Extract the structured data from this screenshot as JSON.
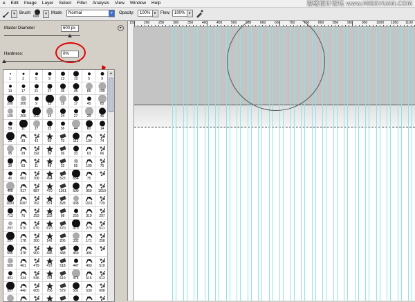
{
  "menubar": [
    "e",
    "Edit",
    "Image",
    "Layer",
    "Select",
    "Filter",
    "Analysis",
    "View",
    "Window",
    "Help"
  ],
  "watermark": "思缘设计论坛 www.MISSVUAN.COM",
  "options": {
    "brush_label": "Brush:",
    "brush_size": "600",
    "mode_label": "Mode:",
    "mode_value": "Normal",
    "opacity_label": "Opacity:",
    "opacity_value": "100%",
    "flow_label": "Flow:",
    "flow_value": "100%"
  },
  "brush_panel": {
    "master_label": "Master Diameter",
    "master_value": "600 px",
    "hardness_label": "Hardness:",
    "hardness_value": "0%",
    "master_level": 0.86,
    "hardness_level": 0.0
  },
  "brush_numbers": [
    [
      "1",
      "3",
      "5",
      "9",
      "13",
      "19",
      "5",
      "9"
    ],
    [
      "13",
      "17",
      "21",
      "27",
      "35",
      "45",
      "65",
      "100"
    ],
    [
      "200",
      "300",
      "9",
      "13",
      "19",
      "17",
      "45",
      "65"
    ],
    [
      "100",
      "200",
      "300",
      "14",
      "24",
      "27",
      "39",
      "46"
    ],
    [
      "59",
      "11",
      "17",
      "23",
      "36",
      "44",
      "60",
      "14"
    ],
    [
      "26",
      "33",
      "42",
      "55",
      "70",
      "112",
      "134",
      "74"
    ],
    [
      "95",
      "29",
      "192",
      "36",
      "36",
      "33",
      "63",
      "66"
    ],
    [
      "39",
      "63",
      "11",
      "48",
      "32",
      "55",
      "100",
      "75"
    ],
    [
      "45",
      "663",
      "706",
      "494",
      "523",
      "654",
      "75",
      ""
    ],
    [
      "466",
      "917",
      "887",
      "470",
      "1361",
      "699",
      "959",
      "1010"
    ],
    [
      "1000",
      "1007",
      "762",
      "531",
      "828",
      "938",
      "1161",
      "729"
    ],
    [
      "713",
      "76",
      "253",
      "332",
      "98",
      "255",
      "310",
      "297"
    ],
    [
      "297",
      "670",
      "670",
      "670",
      "670",
      "473",
      "279",
      "511"
    ],
    [
      "297",
      "178",
      "300",
      "142",
      "206",
      "332",
      "171",
      "258"
    ],
    [
      "595",
      "478",
      "900",
      "446",
      "448",
      "459",
      "496",
      ""
    ],
    [
      "500",
      "461",
      "479",
      "472",
      "518",
      "447",
      "493",
      "510"
    ],
    [
      "491",
      "434",
      "546",
      "741",
      "619",
      "474",
      "515",
      "613"
    ],
    [
      "537",
      "440",
      "605",
      "756",
      "579",
      "561",
      "530",
      "608"
    ],
    [
      "",
      "",
      "",
      "",
      "",
      "",
      "",
      ""
    ]
  ],
  "ruler_labels": [
    "150",
    "200",
    "250",
    "300",
    "350",
    "400",
    "450",
    "500",
    "550",
    "600",
    "650",
    "700",
    "750",
    "800",
    "850",
    "900",
    "950",
    "1000",
    "1050",
    "1100"
  ],
  "colors": {
    "annotation_red": "#e00000",
    "guide_cyan": "#8fe3ea",
    "band_gray": "#c4c4c4"
  }
}
